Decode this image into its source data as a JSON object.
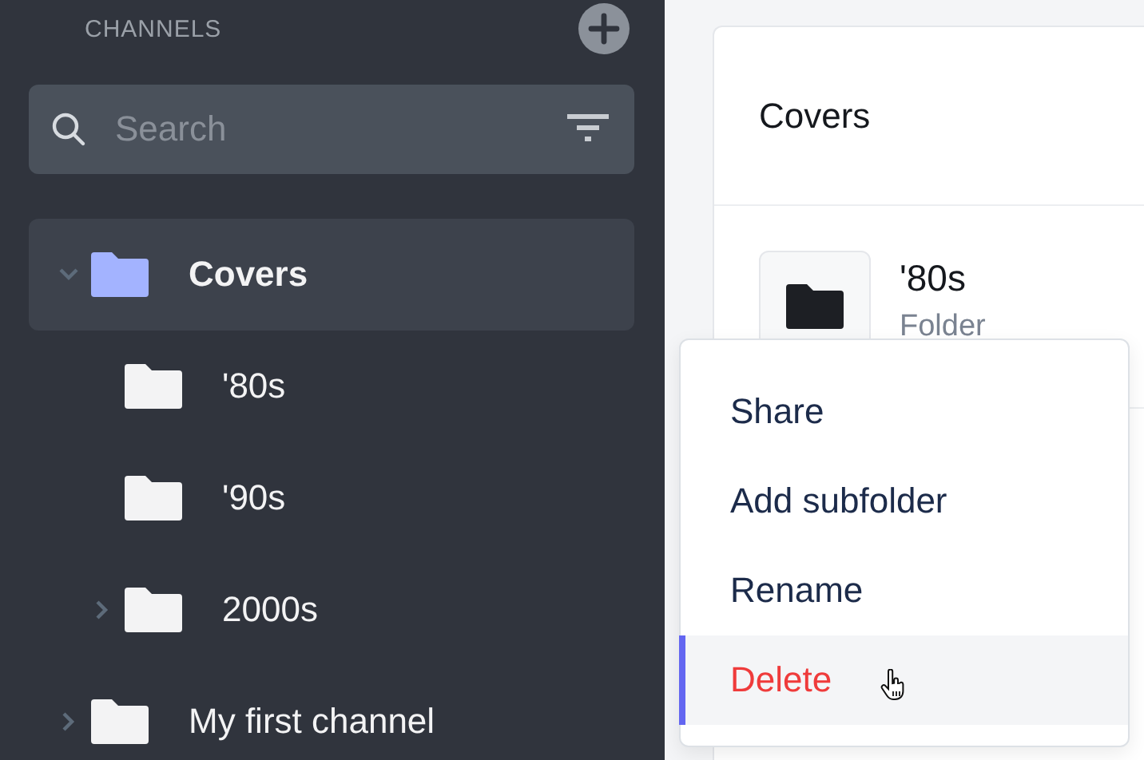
{
  "sidebar": {
    "heading": "CHANNELS",
    "search": {
      "placeholder": "Search"
    },
    "tree": [
      {
        "label": "Covers",
        "selected": true,
        "expandable": true,
        "expanded": true,
        "children": [
          {
            "label": "'80s",
            "selected": false,
            "expandable": false,
            "expanded": false
          },
          {
            "label": "'90s",
            "selected": false,
            "expandable": false,
            "expanded": false
          },
          {
            "label": "2000s",
            "selected": false,
            "expandable": true,
            "expanded": false
          }
        ]
      },
      {
        "label": "My first channel",
        "selected": false,
        "expandable": true,
        "expanded": false
      }
    ]
  },
  "content": {
    "title": "Covers",
    "rows": [
      {
        "title": "'80s",
        "subtitle": "Folder"
      }
    ]
  },
  "context_menu": {
    "items": [
      {
        "label": "Share",
        "kind": "normal",
        "selected": false
      },
      {
        "label": "Add subfolder",
        "kind": "normal",
        "selected": false
      },
      {
        "label": "Rename",
        "kind": "normal",
        "selected": false
      },
      {
        "label": "Delete",
        "kind": "danger",
        "selected": true
      }
    ]
  }
}
